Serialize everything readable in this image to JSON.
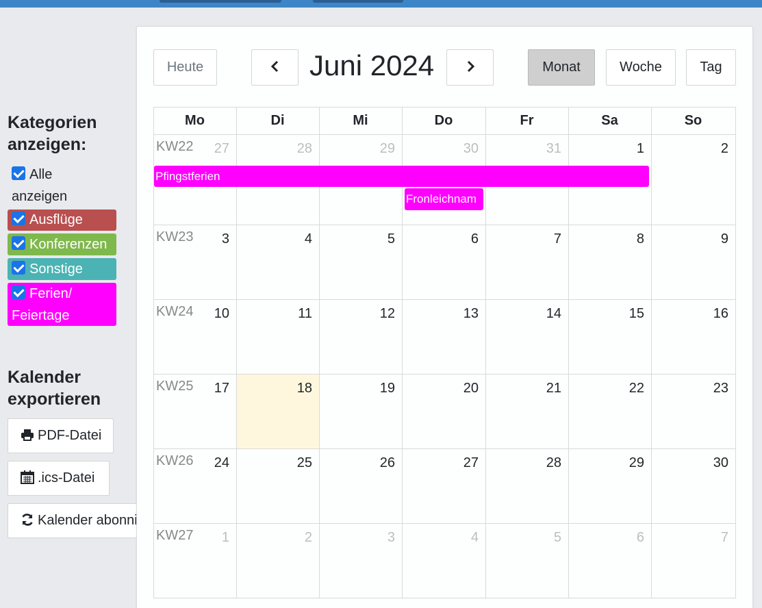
{
  "sidebar": {
    "categories_heading_line1": "Kategorien",
    "categories_heading_line2": "anzeigen:",
    "categories": [
      {
        "label_line1": "Alle",
        "label_line2": "anzeigen",
        "checked": true
      },
      {
        "label": "Ausflüge",
        "checked": true,
        "color": "#b94f4f"
      },
      {
        "label": "Konferenzen",
        "checked": true,
        "color": "#7fb84c"
      },
      {
        "label": "Sonstige",
        "checked": true,
        "color": "#4bb3b3"
      },
      {
        "label_line1": "Ferien/",
        "label_line2": "Feiertage",
        "checked": true,
        "color": "#ff00ff"
      }
    ],
    "export_heading_line1": "Kalender",
    "export_heading_line2": "exportieren",
    "export_buttons": [
      {
        "label": "PDF-Datei",
        "icon": "printer-icon"
      },
      {
        "label": ".ics-Datei",
        "icon": "calendar-icon"
      },
      {
        "label": "Kalender abonnieren",
        "icon": "refresh-icon"
      }
    ]
  },
  "toolbar": {
    "today_label": "Heute",
    "prev_label": "‹",
    "next_label": "›",
    "title": "Juni 2024",
    "views": [
      {
        "label": "Monat",
        "active": true
      },
      {
        "label": "Woche",
        "active": false
      },
      {
        "label": "Tag",
        "active": false
      }
    ]
  },
  "calendar": {
    "weekdays": [
      "Mo",
      "Di",
      "Mi",
      "Do",
      "Fr",
      "Sa",
      "So"
    ],
    "weeks": [
      {
        "kw": "KW22",
        "days": [
          {
            "n": "27",
            "other": true
          },
          {
            "n": "28",
            "other": true
          },
          {
            "n": "29",
            "other": true
          },
          {
            "n": "30",
            "other": true
          },
          {
            "n": "31",
            "other": true
          },
          {
            "n": "1"
          },
          {
            "n": "2"
          }
        ]
      },
      {
        "kw": "KW23",
        "days": [
          {
            "n": "3"
          },
          {
            "n": "4"
          },
          {
            "n": "5"
          },
          {
            "n": "6"
          },
          {
            "n": "7"
          },
          {
            "n": "8"
          },
          {
            "n": "9"
          }
        ]
      },
      {
        "kw": "KW24",
        "days": [
          {
            "n": "10"
          },
          {
            "n": "11"
          },
          {
            "n": "12"
          },
          {
            "n": "13"
          },
          {
            "n": "14"
          },
          {
            "n": "15"
          },
          {
            "n": "16"
          }
        ]
      },
      {
        "kw": "KW25",
        "days": [
          {
            "n": "17"
          },
          {
            "n": "18",
            "today": true
          },
          {
            "n": "19"
          },
          {
            "n": "20"
          },
          {
            "n": "21"
          },
          {
            "n": "22"
          },
          {
            "n": "23"
          }
        ]
      },
      {
        "kw": "KW26",
        "days": [
          {
            "n": "24"
          },
          {
            "n": "25"
          },
          {
            "n": "26"
          },
          {
            "n": "27"
          },
          {
            "n": "28"
          },
          {
            "n": "29"
          },
          {
            "n": "30"
          }
        ]
      },
      {
        "kw": "KW27",
        "days": [
          {
            "n": "1",
            "other": true
          },
          {
            "n": "2",
            "other": true
          },
          {
            "n": "3",
            "other": true
          },
          {
            "n": "4",
            "other": true
          },
          {
            "n": "5",
            "other": true
          },
          {
            "n": "6",
            "other": true
          },
          {
            "n": "7",
            "other": true
          }
        ]
      }
    ],
    "events": [
      {
        "title": "Pfingstferien",
        "color": "#ff00ff"
      },
      {
        "title": "Fronleichnam",
        "color": "#ff00ff"
      }
    ]
  }
}
